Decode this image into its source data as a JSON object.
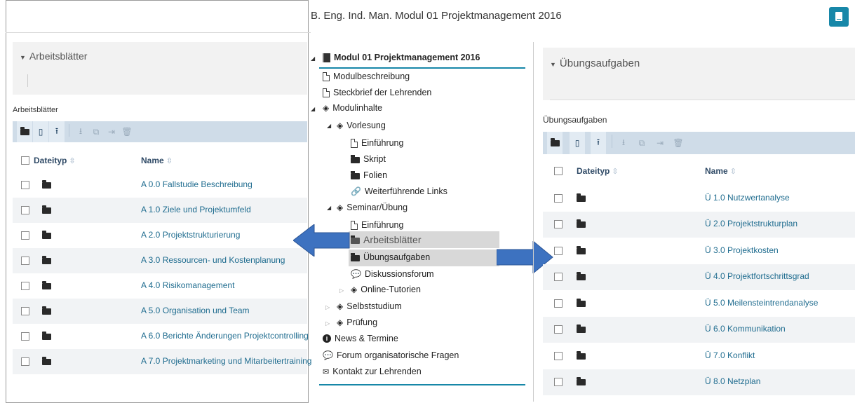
{
  "header": {
    "title": "B. Eng. Ind. Man. Modul 01 Projektmanagement 2016",
    "book_icon": "book-icon"
  },
  "left": {
    "accordion_title": "Arbeitsblätter",
    "section_label": "Arbeitsblätter",
    "col_type": "Dateityp",
    "col_name": "Name",
    "rows": [
      "A 0.0 Fallstudie Beschreibung",
      "A 1.0 Ziele und Projektumfeld",
      "A 2.0 Projektstrukturierung",
      "A 3.0 Ressourcen- und Kostenplanung",
      "A 4.0 Risikomanagement",
      "A 5.0 Organisation und Team",
      "A 6.0 Berichte Änderungen Projektcontrolling",
      "A 7.0 Projektmarketing und Mitarbeitertraining"
    ]
  },
  "tree": {
    "root": "Modul 01 Projektmanagement 2016",
    "items": {
      "modulbeschreibung": "Modulbeschreibung",
      "steckbrief": "Steckbrief der Lehrenden",
      "modulinhalte": "Modulinhalte",
      "vorlesung": "Vorlesung",
      "einfuehrung1": "Einführung",
      "skript": "Skript",
      "folien": "Folien",
      "links": "Weiterführende Links",
      "seminar": "Seminar/Übung",
      "einfuehrung2": "Einführung",
      "arbeitsblaetter": "Arbeitsblätter",
      "uebungsaufgaben": "Übungsaufgaben",
      "diskussionsforum": "Diskussionsforum",
      "online_tutorien": "Online-Tutorien",
      "selbststudium": "Selbststudium",
      "pruefung": "Prüfung",
      "news": "News & Termine",
      "forum": "Forum organisatorische Fragen",
      "kontakt": "Kontakt zur Lehrenden"
    }
  },
  "right": {
    "accordion_title": "Übungsaufgaben",
    "section_label": "Übungsaufgaben",
    "col_type": "Dateityp",
    "col_name": "Name",
    "rows": [
      "Ü 1.0 Nutzwertanalyse",
      "Ü 2.0 Projektstrukturplan",
      "Ü 3.0 Projektkosten",
      "Ü 4.0 Projektfortschrittsgrad",
      "Ü 5.0 Meilensteintrendanalyse",
      "Ü 6.0 Kommunikation",
      "Ü 7.0 Konflikt",
      "Ü 8.0 Netzplan"
    ]
  },
  "colors": {
    "accent": "#1787a8",
    "toolbar": "#cfdce8",
    "link": "#1f6c8f",
    "arrow": "#3d72c0"
  }
}
